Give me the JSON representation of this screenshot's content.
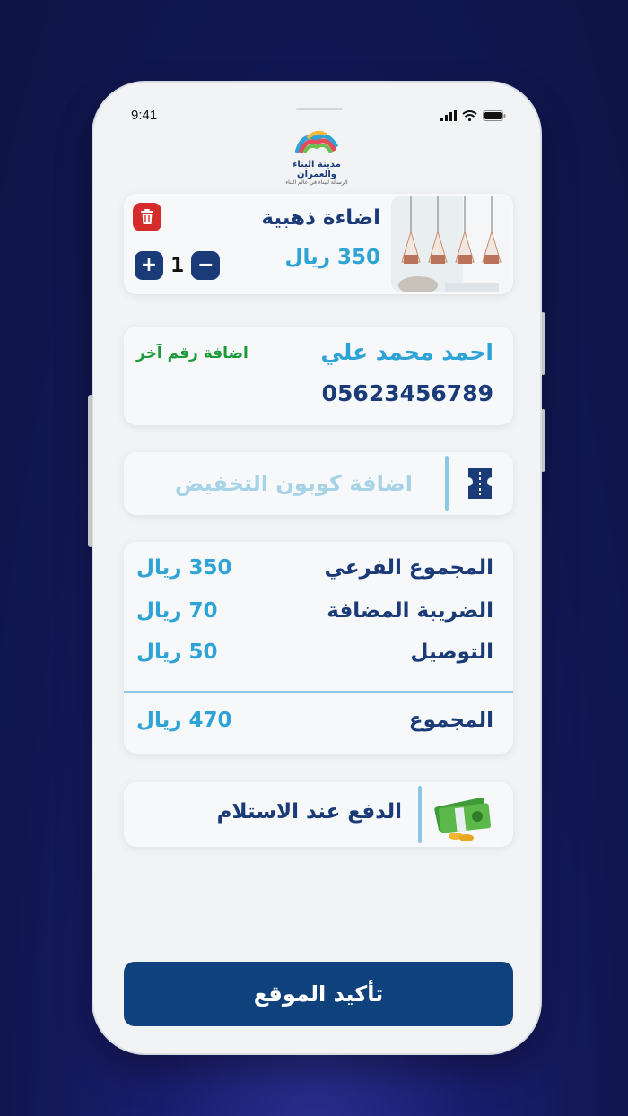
{
  "status": {
    "time": "9:41"
  },
  "brand": {
    "name": "مدينة البناء والعمران",
    "tagline": "الرسالة للبناء في عالم البناء"
  },
  "product": {
    "name": "اضاءة ذهبية",
    "price": "350 ريال",
    "quantity": "1",
    "increment": "+",
    "decrement": "−",
    "image_icon": "pendant-lamps-image"
  },
  "contact": {
    "name": "احمد محمد علي",
    "phone": "05623456789",
    "add_number_label": "اضافة رقم آخر"
  },
  "coupon": {
    "placeholder": "اضافة كوبون التخفيض",
    "icon": "ticket-icon"
  },
  "summary": {
    "rows": [
      {
        "label": "المجموع الفرعي",
        "value": "350 ريال"
      },
      {
        "label": "الضريبة المضافة",
        "value": "70 ريال"
      },
      {
        "label": "التوصيل",
        "value": "50 ريال"
      }
    ],
    "total_label": "المجموع",
    "total_value": "470 ريال"
  },
  "payment": {
    "label": "الدفع عند الاستلام",
    "icon": "cash-icon"
  },
  "confirm": {
    "label": "تأكيد الموقع"
  },
  "colors": {
    "navy": "#1b3b78",
    "blue": "#2ea3d6",
    "green": "#1c9a3a",
    "red": "#d62b2b",
    "button": "#0f427c"
  }
}
